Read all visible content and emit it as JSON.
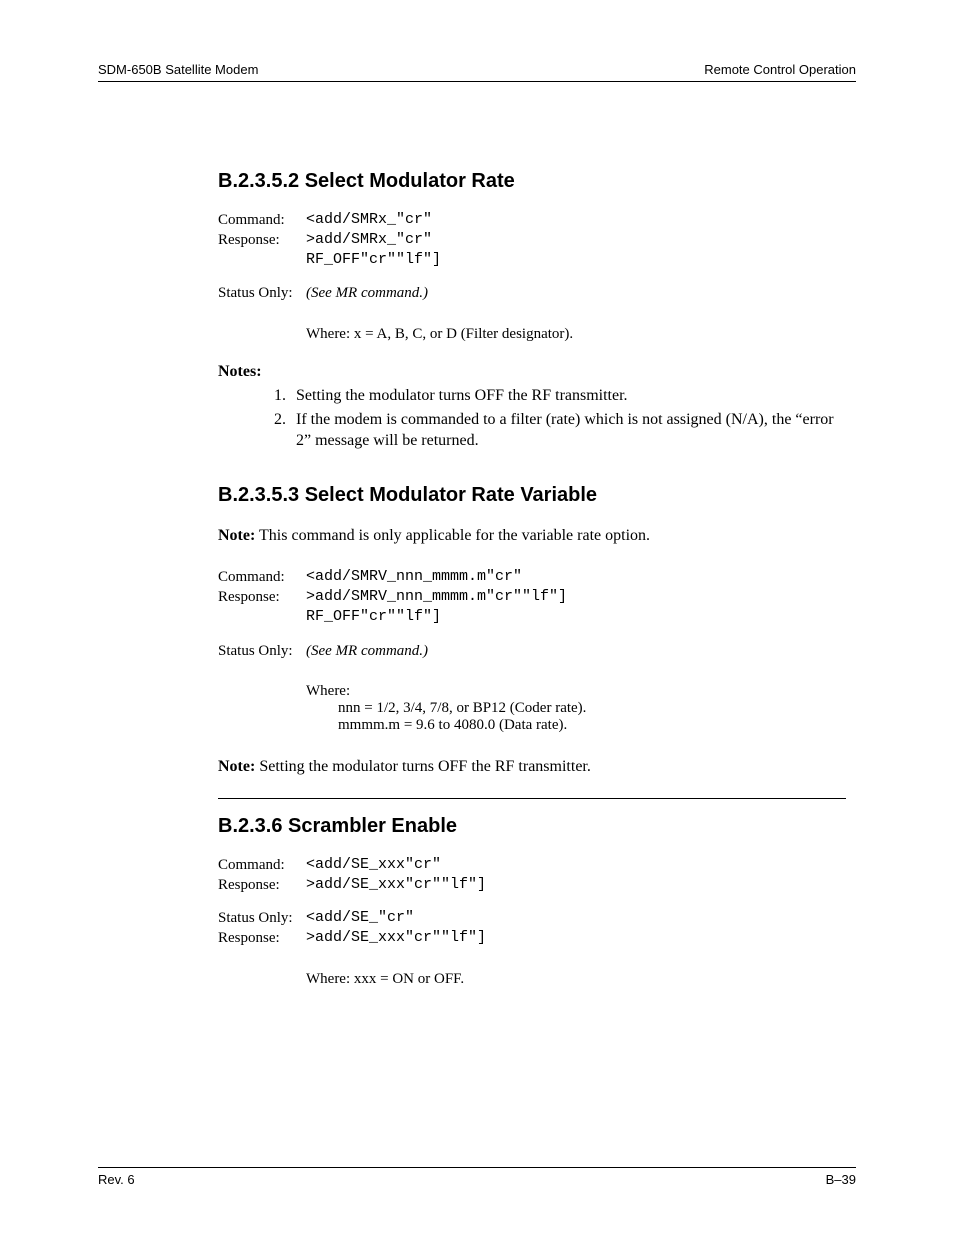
{
  "header": {
    "left": "SDM-650B Satellite Modem",
    "right": "Remote Control Operation"
  },
  "footer": {
    "left": "Rev. 6",
    "right": "B–39"
  },
  "labels": {
    "command": "Command:",
    "response": "Response:",
    "status_only": "Status Only:",
    "notes_heading": "Notes:",
    "note_prefix": "Note:"
  },
  "sec1": {
    "heading": "B.2.3.5.2  Select Modulator Rate",
    "command": "<add/SMRx_\"cr\"",
    "response_l1": ">add/SMRx_\"cr\"",
    "response_l2": "RF_OFF\"cr\"\"lf\"]",
    "status_only_val": "(See MR command.)",
    "where": "Where: x = A, B, C, or D (Filter designator).",
    "notes": {
      "n1": "Setting the modulator turns OFF the RF transmitter.",
      "n2": "If the modem is commanded to a filter (rate) which is not assigned (N/A), the “error 2” message will be returned."
    }
  },
  "sec2": {
    "heading": "B.2.3.5.3  Select Modulator Rate Variable",
    "intro_rest": " This command is only applicable for the variable rate option.",
    "command": "<add/SMRV_nnn_mmmm.m\"cr\"",
    "response_l1": ">add/SMRV_nnn_mmmm.m\"cr\"\"lf\"]",
    "response_l2": "RF_OFF\"cr\"\"lf\"]",
    "status_only_val": "(See MR command.)",
    "where_h": "Where:",
    "where_l1": "nnn = 1/2, 3/4, 7/8, or BP12 (Coder rate).",
    "where_l2": "mmmm.m = 9.6 to 4080.0 (Data rate).",
    "note_rest": " Setting the modulator turns OFF the RF transmitter."
  },
  "sec3": {
    "heading": "B.2.3.6  Scrambler Enable",
    "command": "<add/SE_xxx\"cr\"",
    "response1": ">add/SE_xxx\"cr\"\"lf\"]",
    "status_only": "<add/SE_\"cr\"",
    "response2": ">add/SE_xxx\"cr\"\"lf\"]",
    "where": "Where: xxx = ON or OFF."
  }
}
